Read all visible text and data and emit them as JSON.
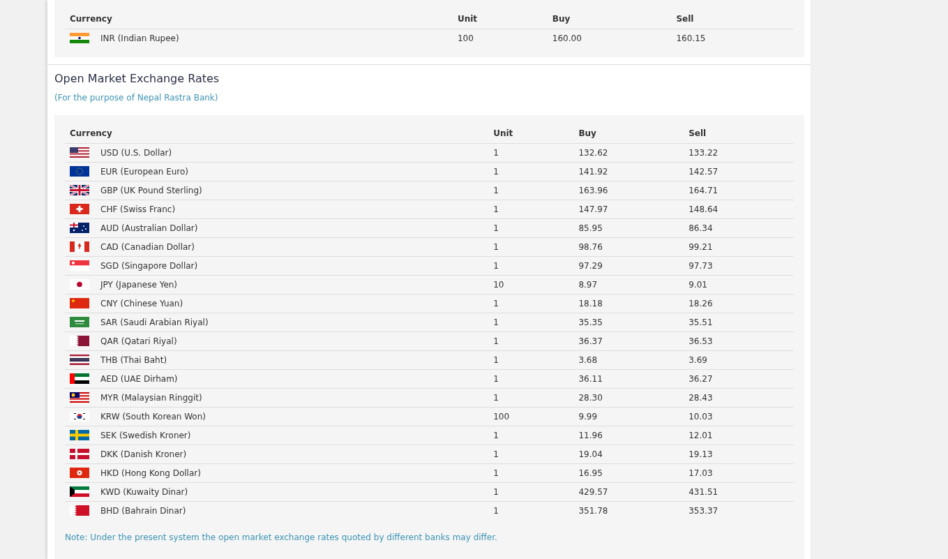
{
  "indian_rates": {
    "columns": [
      "Currency",
      "Unit",
      "Buy",
      "Sell"
    ],
    "rows": [
      {
        "currency": "INR (Indian Rupee)",
        "unit": "100",
        "buy": "160.00",
        "sell": "160.15"
      }
    ]
  },
  "open_market": {
    "title": "Open Market Exchange Rates",
    "subtitle": "(For the purpose of Nepal Rastra Bank)",
    "columns": [
      "Currency",
      "Unit",
      "Buy",
      "Sell"
    ],
    "rows": [
      {
        "currency": "USD (U.S. Dollar)",
        "unit": "1",
        "buy": "132.62",
        "sell": "133.22"
      },
      {
        "currency": "EUR (European Euro)",
        "unit": "1",
        "buy": "141.92",
        "sell": "142.57"
      },
      {
        "currency": "GBP (UK Pound Sterling)",
        "unit": "1",
        "buy": "163.96",
        "sell": "164.71"
      },
      {
        "currency": "CHF (Swiss Franc)",
        "unit": "1",
        "buy": "147.97",
        "sell": "148.64"
      },
      {
        "currency": "AUD (Australian Dollar)",
        "unit": "1",
        "buy": "85.95",
        "sell": "86.34"
      },
      {
        "currency": "CAD (Canadian Dollar)",
        "unit": "1",
        "buy": "98.76",
        "sell": "99.21"
      },
      {
        "currency": "SGD (Singapore Dollar)",
        "unit": "1",
        "buy": "97.29",
        "sell": "97.73"
      },
      {
        "currency": "JPY (Japanese Yen)",
        "unit": "10",
        "buy": "8.97",
        "sell": "9.01"
      },
      {
        "currency": "CNY (Chinese Yuan)",
        "unit": "1",
        "buy": "18.18",
        "sell": "18.26"
      },
      {
        "currency": "SAR (Saudi Arabian Riyal)",
        "unit": "1",
        "buy": "35.35",
        "sell": "35.51"
      },
      {
        "currency": "QAR (Qatari Riyal)",
        "unit": "1",
        "buy": "36.37",
        "sell": "36.53"
      },
      {
        "currency": "THB (Thai Baht)",
        "unit": "1",
        "buy": "3.68",
        "sell": "3.69"
      },
      {
        "currency": "AED (UAE Dirham)",
        "unit": "1",
        "buy": "36.11",
        "sell": "36.27"
      },
      {
        "currency": "MYR (Malaysian Ringgit)",
        "unit": "1",
        "buy": "28.30",
        "sell": "28.43"
      },
      {
        "currency": "KRW (South Korean Won)",
        "unit": "100",
        "buy": "9.99",
        "sell": "10.03"
      },
      {
        "currency": "SEK (Swedish Kroner)",
        "unit": "1",
        "buy": "11.96",
        "sell": "12.01"
      },
      {
        "currency": "DKK (Danish Kroner)",
        "unit": "1",
        "buy": "19.04",
        "sell": "19.13"
      },
      {
        "currency": "HKD (Hong Kong Dollar)",
        "unit": "1",
        "buy": "16.95",
        "sell": "17.03"
      },
      {
        "currency": "KWD (Kuwaity Dinar)",
        "unit": "1",
        "buy": "429.57",
        "sell": "431.51"
      },
      {
        "currency": "BHD (Bahrain Dinar)",
        "unit": "1",
        "buy": "351.78",
        "sell": "353.37"
      }
    ],
    "note": "Note: Under the present system the open market exchange rates quoted by different banks may differ."
  }
}
